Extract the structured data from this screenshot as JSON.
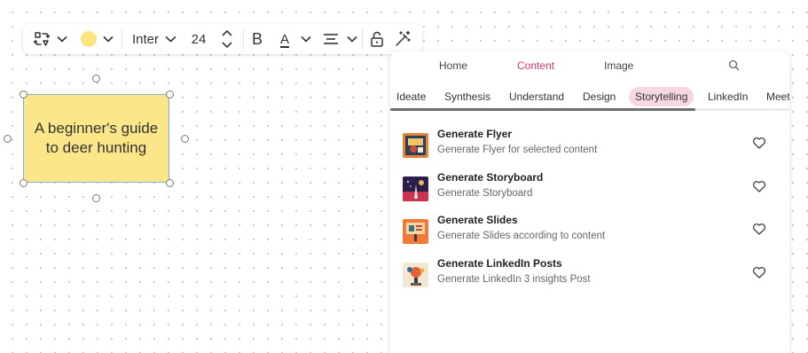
{
  "toolbar": {
    "font_family": "Inter",
    "font_size": "24",
    "bold_label": "B",
    "text_color_label": "A",
    "fill_color": "#fce57e"
  },
  "note": {
    "text": "A beginner's guide to deer hunting",
    "fill_color": "#fce68a"
  },
  "panel": {
    "top_tabs": [
      "Home",
      "Content",
      "Image"
    ],
    "active_top_tab": "Content",
    "sub_tabs": [
      "Ideate",
      "Synthesis",
      "Understand",
      "Design",
      "Storytelling",
      "LinkedIn",
      "Meet"
    ],
    "active_sub_tab": "Storytelling",
    "items": [
      {
        "title": "Generate Flyer",
        "subtitle": "Generate Flyer for selected content",
        "icon": "flyer-thumbnail"
      },
      {
        "title": "Generate Storyboard",
        "subtitle": "Generate Storyboard",
        "icon": "storyboard-thumbnail"
      },
      {
        "title": "Generate Slides",
        "subtitle": "Generate Slides according to content",
        "icon": "slides-thumbnail"
      },
      {
        "title": "Generate LinkedIn Posts",
        "subtitle": "Generate LinkedIn 3 insights Post",
        "icon": "linkedin-thumbnail"
      }
    ],
    "accent_color": "#d6336c"
  }
}
